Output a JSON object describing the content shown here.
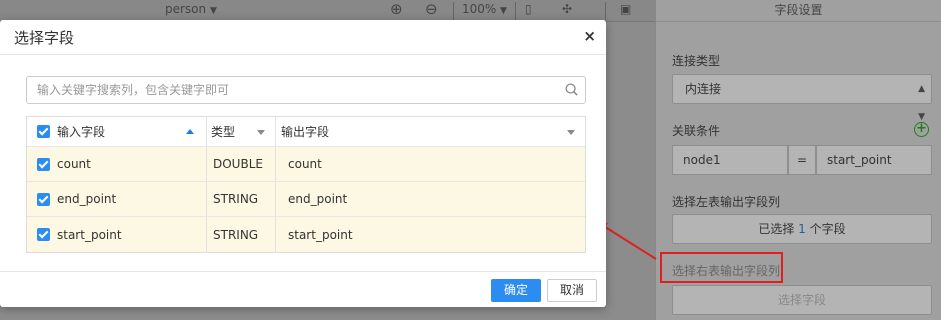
{
  "toolbar": {
    "model_name": "person",
    "zoom": "100%"
  },
  "panel": {
    "header": "字段设置",
    "join_type_label": "连接类型",
    "join_type_value": "内连接",
    "condition_label": "关联条件",
    "condition_left": "node1",
    "condition_op": "=",
    "condition_right": "start_point",
    "left_output_label": "选择左表输出字段列",
    "left_output_prefix": "已选择",
    "left_output_count": "1",
    "left_output_suffix": "个字段",
    "right_output_label": "选择右表输出字段列",
    "right_output_button": "选择字段"
  },
  "dialog": {
    "title": "选择字段",
    "close": "×",
    "search_placeholder": "输入关键字搜索列，包含关键字即可",
    "columns": {
      "input": "输入字段",
      "type": "类型",
      "output": "输出字段"
    },
    "rows": [
      {
        "input": "count",
        "type": "DOUBLE",
        "output": "count"
      },
      {
        "input": "end_point",
        "type": "STRING",
        "output": "end_point"
      },
      {
        "input": "start_point",
        "type": "STRING",
        "output": "start_point"
      }
    ],
    "ok": "确定",
    "cancel": "取消"
  },
  "colors": {
    "primary": "#2d8cf0",
    "row_highlight": "#fcf8e3",
    "annotation": "#e02020"
  }
}
